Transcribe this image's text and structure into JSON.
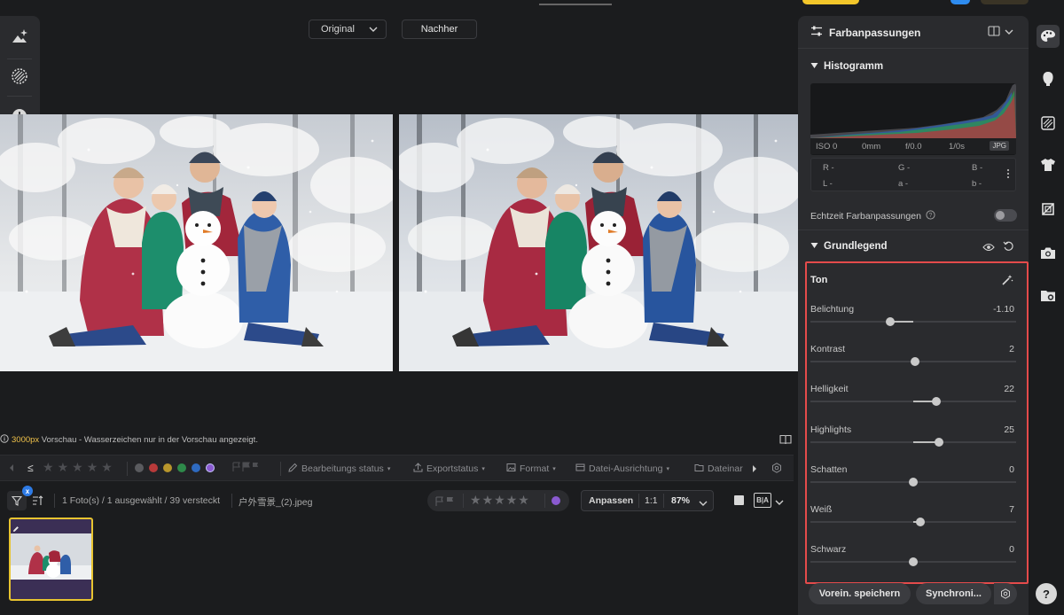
{
  "viewer": {
    "compare_left_select": "Original",
    "compare_right_button": "Nachher",
    "preview_px": "3000px",
    "preview_note": " Vorschau - Wasserzeichen nur in der Vorschau angezeigt."
  },
  "filter_bar": {
    "items": [
      "Bearbeitungs status",
      "Exportstatus",
      "Format",
      "Datei-Ausrichtung",
      "Dateinar"
    ],
    "color_labels": [
      "#5a5b5f",
      "#b83a3a",
      "#b8962c",
      "#2e8a4a",
      "#2e6ac0",
      "#8a5ad0"
    ]
  },
  "info_bar": {
    "photo_count": "1 Foto(s) / 1 ausgewählt / 39 versteckt",
    "filename": "户外雪景_(2).jpeg",
    "fit_label": "Anpassen",
    "one_to_one": "1:1",
    "zoom": "87%",
    "filter_badge": "x"
  },
  "panel": {
    "title": "Farbanpassungen",
    "histogram_label": "Histogramm",
    "exif": {
      "iso": "ISO 0",
      "focal": "0mm",
      "aperture": "f/0.0",
      "shutter": "1/0s",
      "format": "JPG"
    },
    "lab": {
      "r": "R -",
      "g": "G -",
      "b": "B -",
      "l": "L -",
      "a": "a -",
      "b2": "b -"
    },
    "realtime_label": "Echtzeit Farbanpassungen",
    "basic_label": "Grundlegend",
    "tone_label": "Ton",
    "sliders": [
      {
        "name": "Belichtung",
        "value": "-1.10",
        "level": -1.1,
        "range": 5
      },
      {
        "name": "Kontrast",
        "value": "2",
        "level": 2,
        "range": 100
      },
      {
        "name": "Helligkeit",
        "value": "22",
        "level": 22,
        "range": 100
      },
      {
        "name": "Highlights",
        "value": "25",
        "level": 25,
        "range": 100
      },
      {
        "name": "Schatten",
        "value": "0",
        "level": 0,
        "range": 100
      },
      {
        "name": "Weiß",
        "value": "7",
        "level": 7,
        "range": 100
      },
      {
        "name": "Schwarz",
        "value": "0",
        "level": 0,
        "range": 100
      }
    ],
    "save_preset_button": "Vorein. speichern",
    "sync_button": "Synchroni..."
  },
  "help_label": "?"
}
